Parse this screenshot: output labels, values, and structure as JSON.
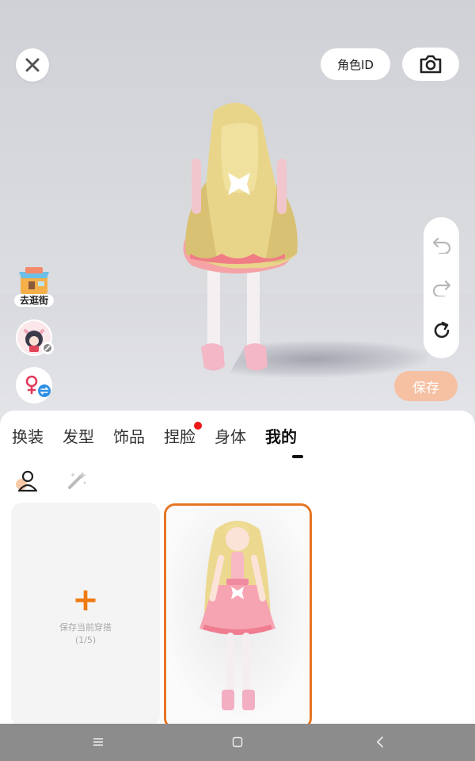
{
  "header": {
    "role_id_label": "角色ID"
  },
  "side": {
    "shop_label": "去逛街"
  },
  "actions": {
    "save_label": "保存"
  },
  "tabs": [
    {
      "label": "换装",
      "active": false,
      "badge": false
    },
    {
      "label": "发型",
      "active": false,
      "badge": false
    },
    {
      "label": "饰品",
      "active": false,
      "badge": false
    },
    {
      "label": "捏脸",
      "active": false,
      "badge": true
    },
    {
      "label": "身体",
      "active": false,
      "badge": false
    },
    {
      "label": "我的",
      "active": true,
      "badge": false
    }
  ],
  "saved_outfits": {
    "save_current_label": "保存当前穿搭",
    "count_label": "(1/5)"
  },
  "colors": {
    "accent_orange": "#f07a12",
    "selected_border": "#e67524",
    "save_button": "#f6c0a3",
    "badge_red": "#f01818"
  },
  "icons": {
    "close": "close-icon",
    "camera": "camera-icon",
    "undo": "undo-icon",
    "redo": "redo-icon",
    "reset": "reset-icon",
    "shop": "shop-icon",
    "gender": "gender-swap-icon"
  }
}
